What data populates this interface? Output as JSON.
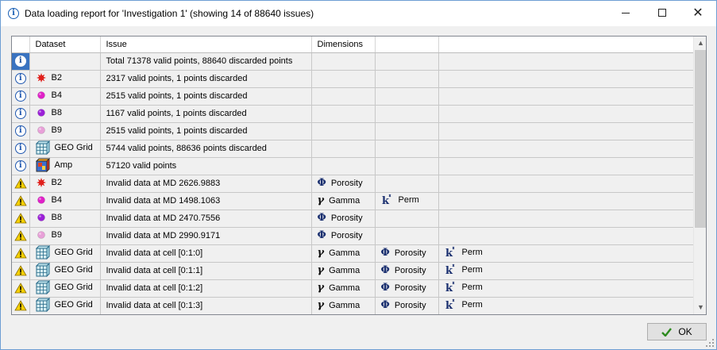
{
  "window": {
    "title": "Data loading report for 'Investigation 1' (showing 14 of 88640 issues)",
    "ok_label": "OK"
  },
  "columns": [
    "",
    "Dataset",
    "Issue",
    "Dimensions",
    "",
    ""
  ],
  "colors": {
    "b2_star": "#e0201c",
    "b4_dot": "#e020c8",
    "b8_dot": "#9b20d8",
    "b9_dot": "#e8a0d8",
    "info_blue": "#2058b0",
    "warn_yellow": "#f5d000",
    "selected_blue": "#3a73c0"
  },
  "rows": [
    {
      "severity": "info",
      "dataset": "",
      "icon": "",
      "issue": "Total 71378 valid points, 88640 discarded points",
      "dims": []
    },
    {
      "severity": "info",
      "dataset": "B2",
      "icon": "red-star-icon",
      "issue": "2317 valid points, 1 points discarded",
      "dims": []
    },
    {
      "severity": "info",
      "dataset": "B4",
      "icon": "magenta-dot-icon",
      "issue": "2515 valid points, 1 points discarded",
      "dims": []
    },
    {
      "severity": "info",
      "dataset": "B8",
      "icon": "purple-dot-icon",
      "issue": "1167 valid points, 1 points discarded",
      "dims": []
    },
    {
      "severity": "info",
      "dataset": "B9",
      "icon": "pink-dot-icon",
      "issue": "2515 valid points, 1 points discarded",
      "dims": []
    },
    {
      "severity": "info",
      "dataset": "GEO Grid",
      "icon": "grid-cube-icon",
      "issue": "5744 valid points, 88636 points discarded",
      "dims": []
    },
    {
      "severity": "info",
      "dataset": "Amp",
      "icon": "amp-cube-icon",
      "issue": "57120 valid points",
      "dims": []
    },
    {
      "severity": "warning",
      "dataset": "B2",
      "icon": "red-star-icon",
      "issue": "Invalid data at MD 2626.9883",
      "dims": [
        {
          "sym": "Φ",
          "label": "Porosity"
        }
      ]
    },
    {
      "severity": "warning",
      "dataset": "B4",
      "icon": "magenta-dot-icon",
      "issue": "Invalid data at MD 1498.1063",
      "dims": [
        {
          "sym": "γ",
          "label": "Gamma"
        },
        {
          "sym": "k",
          "label": "Perm"
        }
      ]
    },
    {
      "severity": "warning",
      "dataset": "B8",
      "icon": "purple-dot-icon",
      "issue": "Invalid data at MD 2470.7556",
      "dims": [
        {
          "sym": "Φ",
          "label": "Porosity"
        }
      ]
    },
    {
      "severity": "warning",
      "dataset": "B9",
      "icon": "pink-dot-icon",
      "issue": "Invalid data at MD 2990.9171",
      "dims": [
        {
          "sym": "Φ",
          "label": "Porosity"
        }
      ]
    },
    {
      "severity": "warning",
      "dataset": "GEO Grid",
      "icon": "grid-cube-icon",
      "issue": "Invalid data at cell [0:1:0]",
      "dims": [
        {
          "sym": "γ",
          "label": "Gamma"
        },
        {
          "sym": "Φ",
          "label": "Porosity"
        },
        {
          "sym": "k",
          "label": "Perm"
        }
      ]
    },
    {
      "severity": "warning",
      "dataset": "GEO Grid",
      "icon": "grid-cube-icon",
      "issue": "Invalid data at cell [0:1:1]",
      "dims": [
        {
          "sym": "γ",
          "label": "Gamma"
        },
        {
          "sym": "Φ",
          "label": "Porosity"
        },
        {
          "sym": "k",
          "label": "Perm"
        }
      ]
    },
    {
      "severity": "warning",
      "dataset": "GEO Grid",
      "icon": "grid-cube-icon",
      "issue": "Invalid data at cell [0:1:2]",
      "dims": [
        {
          "sym": "γ",
          "label": "Gamma"
        },
        {
          "sym": "Φ",
          "label": "Porosity"
        },
        {
          "sym": "k",
          "label": "Perm"
        }
      ]
    },
    {
      "severity": "warning",
      "dataset": "GEO Grid",
      "icon": "grid-cube-icon",
      "issue": "Invalid data at cell [0:1:3]",
      "dims": [
        {
          "sym": "γ",
          "label": "Gamma"
        },
        {
          "sym": "Φ",
          "label": "Porosity"
        },
        {
          "sym": "k",
          "label": "Perm"
        }
      ]
    }
  ]
}
